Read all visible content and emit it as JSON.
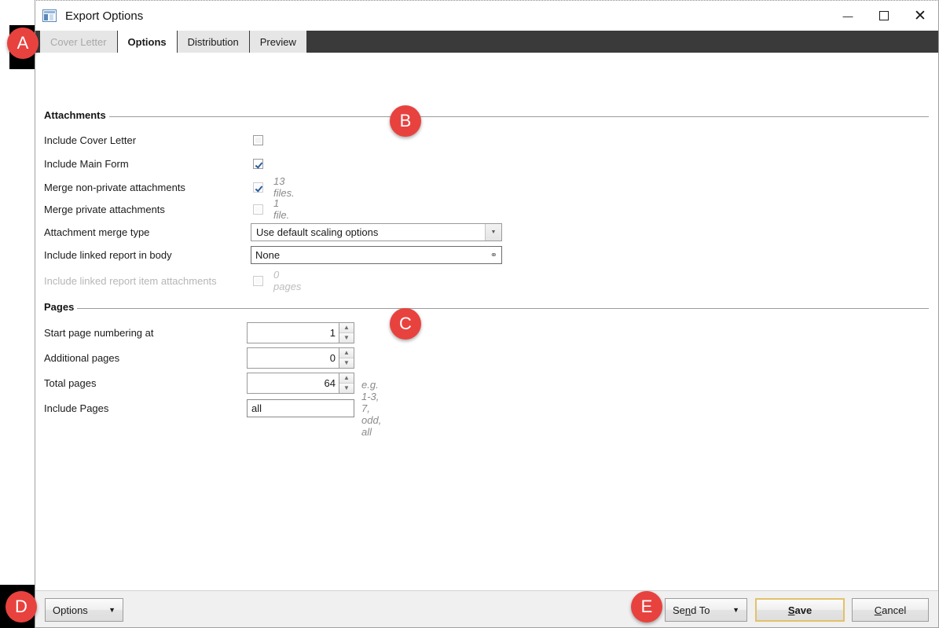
{
  "window": {
    "title": "Export Options",
    "icon": "form-window-icon",
    "controls": {
      "minimize": "—",
      "maximize": "",
      "close": "✕"
    }
  },
  "tabs": [
    {
      "label": "Cover Letter",
      "state": "disabled"
    },
    {
      "label": "Options",
      "state": "active"
    },
    {
      "label": "Distribution",
      "state": "normal"
    },
    {
      "label": "Preview",
      "state": "normal"
    }
  ],
  "attachments": {
    "title": "Attachments",
    "rows": [
      {
        "label": "Include Cover Letter",
        "checked": false,
        "note": ""
      },
      {
        "label": "Include Main Form",
        "checked": true,
        "note": ""
      },
      {
        "label": "Merge non-private attachments",
        "checked": true,
        "note": "13 files."
      },
      {
        "label": "Merge private attachments",
        "checked": false,
        "note": "1 file."
      }
    ],
    "merge_type_label": "Attachment merge type",
    "merge_type_value": "Use default scaling options",
    "linked_report_label": "Include linked report in body",
    "linked_report_value": "None",
    "linked_report_icon": "link-chain-icon",
    "linked_items_label": "Include linked report item attachments",
    "linked_items_checked": false,
    "linked_items_note": "0 pages"
  },
  "pages": {
    "title": "Pages",
    "start_label": "Start page numbering at",
    "start_value": "1",
    "additional_label": "Additional pages",
    "additional_value": "0",
    "total_label": "Total pages",
    "total_value": "64",
    "include_label": "Include Pages",
    "include_value": "all",
    "include_hint": "e.g. 1-3, 7, odd, all"
  },
  "footer": {
    "options_label": "Options",
    "send_to_label": "Send To",
    "send_to_accel": "n",
    "save_label": "Save",
    "save_accel": "S",
    "cancel_label": "Cancel",
    "cancel_accel": "C"
  },
  "markers": [
    {
      "id": "A",
      "label": "A"
    },
    {
      "id": "B",
      "label": "B"
    },
    {
      "id": "C",
      "label": "C"
    },
    {
      "id": "D",
      "label": "D"
    },
    {
      "id": "E",
      "label": "E"
    }
  ],
  "colors": {
    "marker": "#e8423f",
    "tabstrip": "#3a3a3a",
    "default_button_border": "#e3c16a"
  }
}
